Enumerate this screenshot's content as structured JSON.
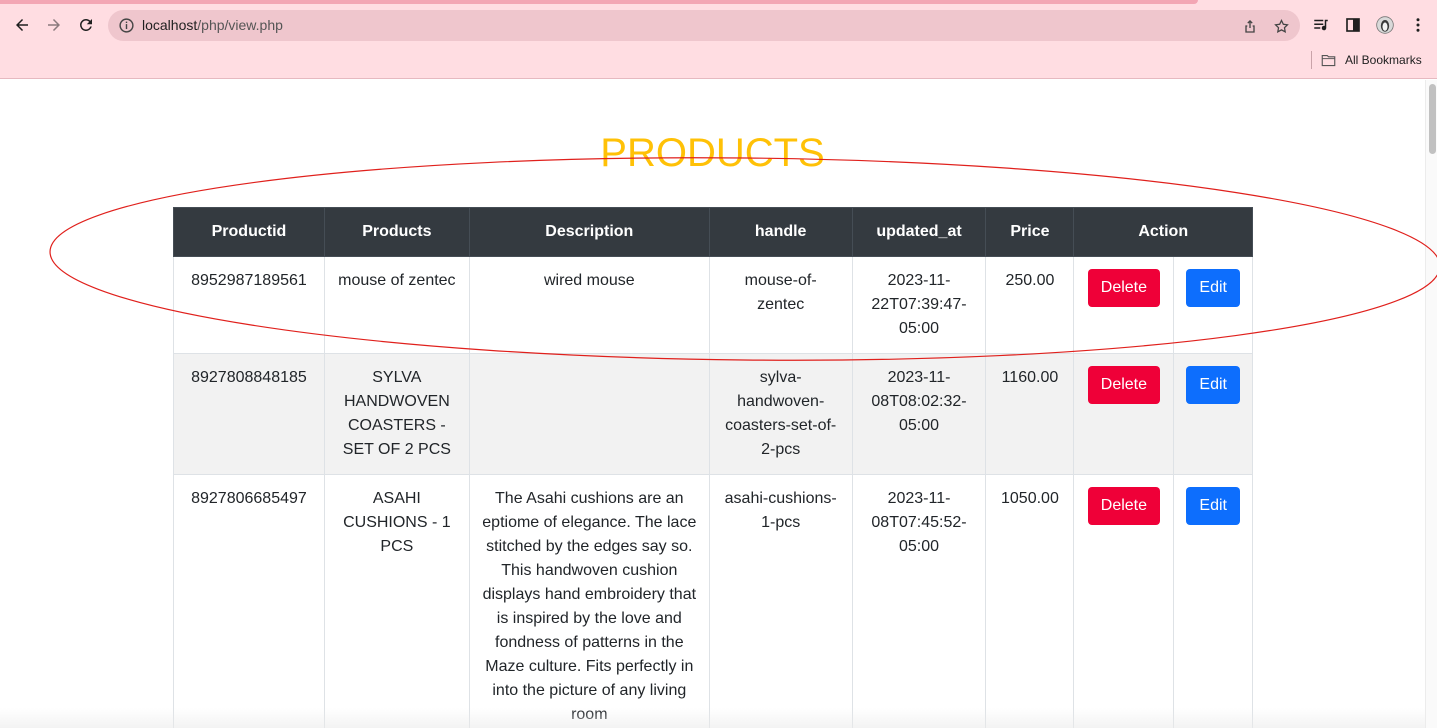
{
  "browser": {
    "url_host": "localhost",
    "url_path": "/php/view.php",
    "bookmarks_label": "All Bookmarks"
  },
  "page": {
    "title": "PRODUCTS"
  },
  "table": {
    "headers": [
      "Productid",
      "Products",
      "Description",
      "handle",
      "updated_at",
      "Price",
      "Action"
    ],
    "rows": [
      {
        "productid": "8952987189561",
        "product": "mouse of zentec",
        "description": "wired mouse",
        "handle": "mouse-of-zentec",
        "updated_at": "2023-11-22T07:39:47-05:00",
        "price": "250.00",
        "delete_label": "Delete",
        "edit_label": "Edit"
      },
      {
        "productid": "8927808848185",
        "product": "SYLVA HANDWOVEN COASTERS - SET OF 2 PCS",
        "description": "",
        "handle": "sylva-handwoven-coasters-set-of-2-pcs",
        "updated_at": "2023-11-08T08:02:32-05:00",
        "price": "1160.00",
        "delete_label": "Delete",
        "edit_label": "Edit"
      },
      {
        "productid": "8927806685497",
        "product": "ASAHI CUSHIONS - 1 PCS",
        "description": "The Asahi cushions are an eptiome of elegance. The lace stitched by the edges say so. This handwoven cushion displays hand embroidery that is inspired by the love and fondness of patterns in the Maze culture. Fits perfectly in into the picture of any living room",
        "handle": "asahi-cushions-1-pcs",
        "updated_at": "2023-11-08T07:45:52-05:00",
        "price": "1050.00",
        "delete_label": "Delete",
        "edit_label": "Edit"
      }
    ]
  },
  "colors": {
    "title": "#ffc107",
    "header_bg": "#343a40",
    "delete": "#ef0038",
    "edit": "#0d6efd",
    "annotation": "#e0201c"
  }
}
